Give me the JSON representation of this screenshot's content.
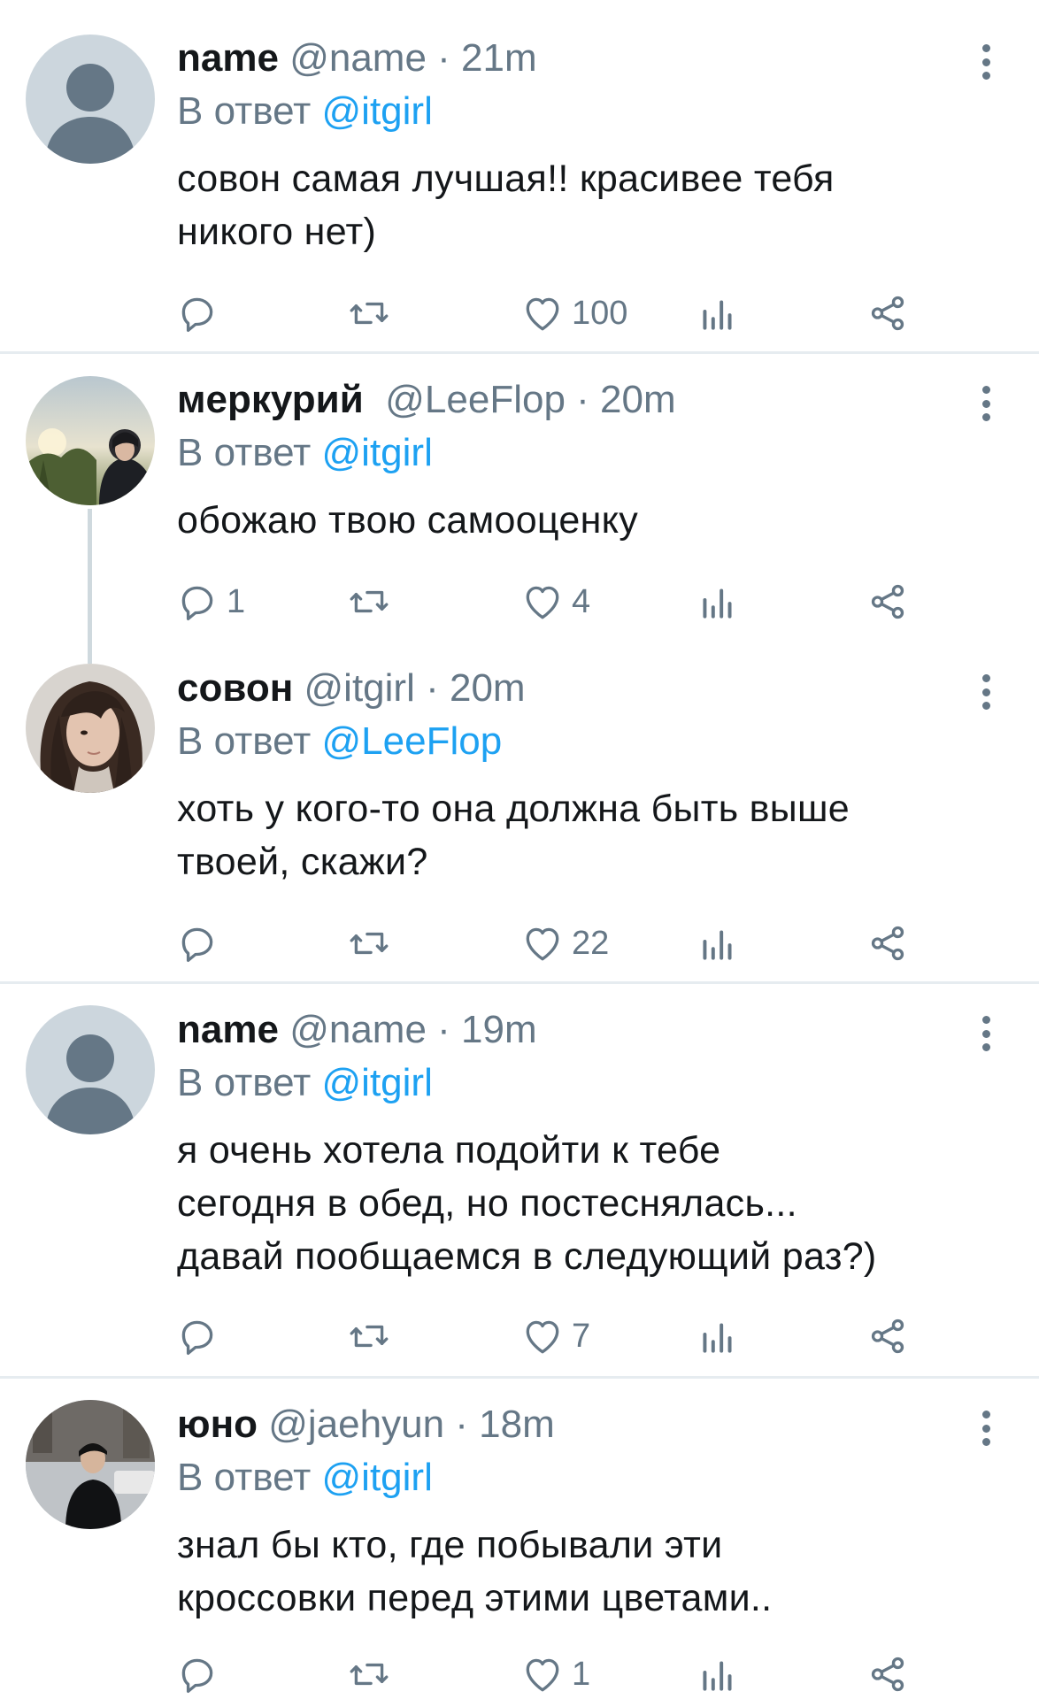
{
  "tweets": [
    {
      "name": "name",
      "handle": "@name",
      "time": "21m",
      "reply_prefix": "В ответ",
      "reply_to": "@itgirl",
      "body_lines": [
        "совон самая лучшая!! красивее тебя",
        "никого нет)"
      ],
      "replies": "",
      "retweets": "",
      "likes": "100",
      "avatar": "default-avatar"
    },
    {
      "name": "меркурий",
      "handle": "@LeeFlop",
      "time": "20m",
      "reply_prefix": "В ответ",
      "reply_to": "@itgirl",
      "body_lines": [
        "обожаю твою самооценку"
      ],
      "replies": "1",
      "retweets": "",
      "likes": "4",
      "avatar": "photo-avatar"
    },
    {
      "name": "совон",
      "handle": "@itgirl",
      "time": "20m",
      "reply_prefix": "В ответ",
      "reply_to": "@LeeFlop",
      "body_lines": [
        "хоть у кого-то она должна быть выше",
        "твоей, скажи?"
      ],
      "replies": "",
      "retweets": "",
      "likes": "22",
      "avatar": "photo-avatar"
    },
    {
      "name": "name",
      "handle": "@name",
      "time": "19m",
      "reply_prefix": "В ответ",
      "reply_to": "@itgirl",
      "body_lines": [
        "я очень хотела подойти к тебе",
        "сегодня в обед, но постеснялась...",
        "давай пообщаемся в следующий раз?)"
      ],
      "replies": "",
      "retweets": "",
      "likes": "7",
      "avatar": "default-avatar"
    },
    {
      "name": "юно",
      "handle": "@jaehyun",
      "time": "18m",
      "reply_prefix": "В ответ",
      "reply_to": "@itgirl",
      "body_lines": [
        "знал бы кто, где побывали эти",
        "кроссовки перед этими цветами.."
      ],
      "replies": "",
      "retweets": "",
      "likes": "1",
      "avatar": "photo-avatar"
    }
  ],
  "separator": " · ",
  "icons": {
    "reply": "reply-icon",
    "retweet": "retweet-icon",
    "like": "heart-icon",
    "stats": "stats-icon",
    "share": "share-icon",
    "more": "more-vertical-icon"
  },
  "colors": {
    "text": "#14171a",
    "secondary": "#657786",
    "link": "#1da1f2",
    "divider": "#e6ecf0",
    "avatar_placeholder": "#ccd6dd"
  }
}
